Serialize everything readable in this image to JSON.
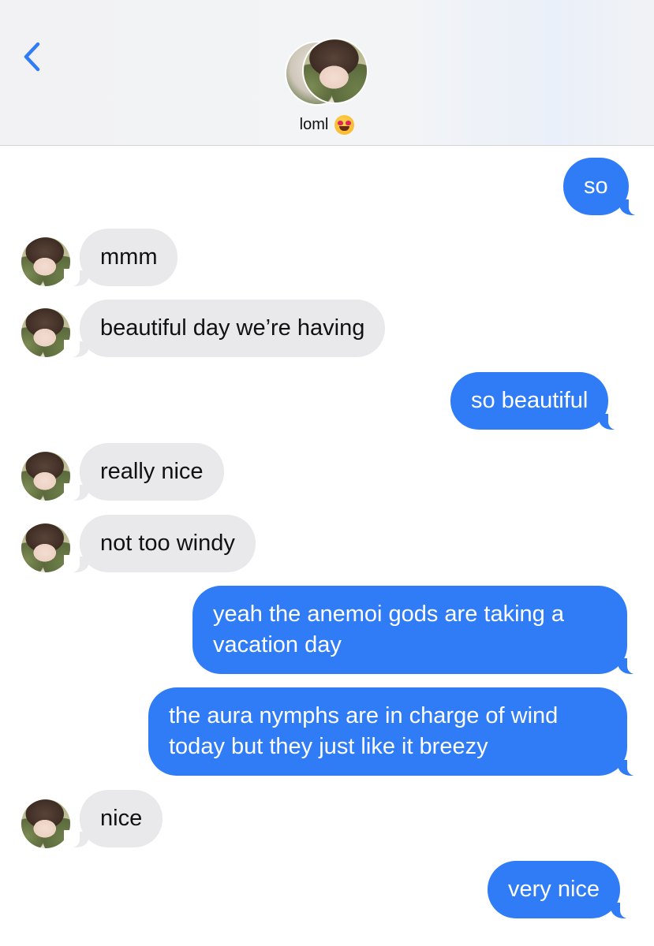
{
  "header": {
    "back_icon": "chevron-left-icon",
    "contact_name": "loml",
    "contact_emoji": "heart-eyes-emoji",
    "accent_color": "#2f7cf6"
  },
  "messages": [
    {
      "from": "me",
      "text": "so"
    },
    {
      "from": "them",
      "text": "mmm"
    },
    {
      "from": "them",
      "text": "beautiful day we’re having"
    },
    {
      "from": "me",
      "text": "so beautiful"
    },
    {
      "from": "them",
      "text": "really nice"
    },
    {
      "from": "them",
      "text": "not too windy"
    },
    {
      "from": "me",
      "text": "yeah the anemoi gods are taking a vacation day"
    },
    {
      "from": "me",
      "text": "the aura nymphs are in charge of wind today but they just like it breezy"
    },
    {
      "from": "them",
      "text": "nice"
    },
    {
      "from": "me",
      "text": "very nice"
    }
  ],
  "colors": {
    "outgoing_bubble": "#2f7cf6",
    "incoming_bubble": "#e9e9eb",
    "header_bg": "#f2f2f4"
  }
}
